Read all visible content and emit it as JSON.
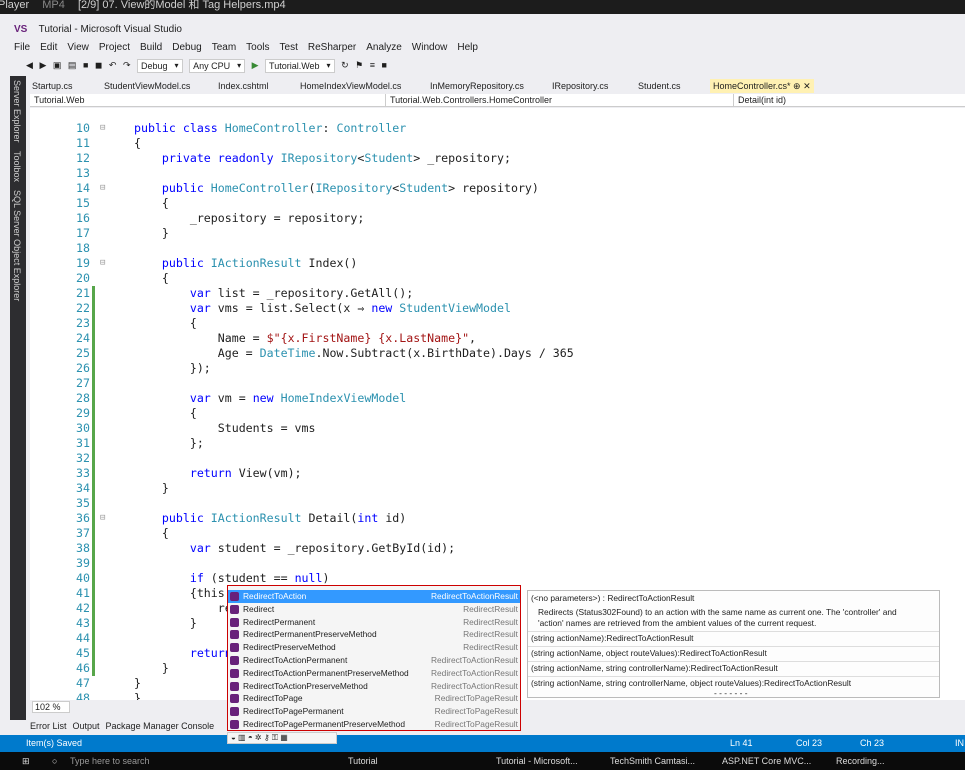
{
  "player": {
    "app": "Player",
    "format": "MP4",
    "title": "[2/9] 07. View的Model 和 Tag Helpers.mp4"
  },
  "window": {
    "title": "Tutorial - Microsoft Visual Studio",
    "logo": "VS"
  },
  "menu": [
    "File",
    "Edit",
    "View",
    "Project",
    "Build",
    "Debug",
    "Team",
    "Tools",
    "Test",
    "ReSharper",
    "Analyze",
    "Window",
    "Help"
  ],
  "toolbar": {
    "config": "Debug",
    "platform": "Any CPU",
    "run": "Tutorial.Web"
  },
  "side_panels": [
    "Server Explorer",
    "Toolbox",
    "SQL Server Object Explorer"
  ],
  "tabs": [
    "Startup.cs",
    "StudentViewModel.cs",
    "Index.cshtml",
    "HomeIndexViewModel.cs",
    "InMemoryRepository.cs",
    "IRepository.cs",
    "Student.cs",
    "HomeController.cs*"
  ],
  "nav": {
    "project": "Tutorial.Web",
    "class": "Tutorial.Web.Controllers.HomeController",
    "member": "Detail(int id)"
  },
  "code": [
    {
      "n": "10",
      "t": "public class HomeController: Controller"
    },
    {
      "n": "11",
      "t": "{"
    },
    {
      "n": "12",
      "t": "    private readonly IRepository<Student> _repository;"
    },
    {
      "n": "13",
      "t": ""
    },
    {
      "n": "14",
      "t": "    public HomeController(IRepository<Student> repository)"
    },
    {
      "n": "15",
      "t": "    {"
    },
    {
      "n": "16",
      "t": "        _repository = repository;"
    },
    {
      "n": "17",
      "t": "    }"
    },
    {
      "n": "18",
      "t": ""
    },
    {
      "n": "19",
      "t": "    public IActionResult Index()"
    },
    {
      "n": "20",
      "t": "    {"
    },
    {
      "n": "21",
      "t": "        var list = _repository.GetAll();"
    },
    {
      "n": "22",
      "t": "        var vms = list.Select(x ⇒ new StudentViewModel"
    },
    {
      "n": "23",
      "t": "        {"
    },
    {
      "n": "24",
      "t": "            Name = $\"{x.FirstName} {x.LastName}\","
    },
    {
      "n": "25",
      "t": "            Age = DateTime.Now.Subtract(x.BirthDate).Days / 365"
    },
    {
      "n": "26",
      "t": "        });"
    },
    {
      "n": "27",
      "t": ""
    },
    {
      "n": "28",
      "t": "        var vm = new HomeIndexViewModel"
    },
    {
      "n": "29",
      "t": "        {"
    },
    {
      "n": "30",
      "t": "            Students = vms"
    },
    {
      "n": "31",
      "t": "        };"
    },
    {
      "n": "32",
      "t": ""
    },
    {
      "n": "33",
      "t": "        return View(vm);"
    },
    {
      "n": "34",
      "t": "    }"
    },
    {
      "n": "35",
      "t": ""
    },
    {
      "n": "36",
      "t": "    public IActionResult Detail(int id)"
    },
    {
      "n": "37",
      "t": "    {"
    },
    {
      "n": "38",
      "t": "        var student = _repository.GetById(id);"
    },
    {
      "n": "39",
      "t": ""
    },
    {
      "n": "40",
      "t": "        if (student == null)"
    },
    {
      "n": "41",
      "t": "        {this.redi"
    },
    {
      "n": "42",
      "t": "            re"
    },
    {
      "n": "43",
      "t": "        }"
    },
    {
      "n": "44",
      "t": ""
    },
    {
      "n": "45",
      "t": "        return"
    },
    {
      "n": "46",
      "t": "    }"
    },
    {
      "n": "47",
      "t": "}"
    },
    {
      "n": "48",
      "t": "}"
    }
  ],
  "zoom": "102 %",
  "bottom_tabs": [
    "Error List",
    "Output",
    "Package Manager Console"
  ],
  "status": {
    "msg": "Item(s) Saved",
    "ln": "Ln 41",
    "col": "Col 23",
    "ch": "Ch 23",
    "mode": "IN"
  },
  "intellisense": [
    {
      "name": "RedirectToAction",
      "ret": "RedirectToActionResult"
    },
    {
      "name": "Redirect",
      "ret": "RedirectResult"
    },
    {
      "name": "RedirectPermanent",
      "ret": "RedirectResult"
    },
    {
      "name": "RedirectPermanentPreserveMethod",
      "ret": "RedirectResult"
    },
    {
      "name": "RedirectPreserveMethod",
      "ret": "RedirectResult"
    },
    {
      "name": "RedirectToActionPermanent",
      "ret": "RedirectToActionResult"
    },
    {
      "name": "RedirectToActionPermanentPreserveMethod",
      "ret": "RedirectToActionResult"
    },
    {
      "name": "RedirectToActionPreserveMethod",
      "ret": "RedirectToActionResult"
    },
    {
      "name": "RedirectToPage",
      "ret": "RedirectToPageResult"
    },
    {
      "name": "RedirectToPagePermanent",
      "ret": "RedirectToPageResult"
    },
    {
      "name": "RedirectToPagePermanentPreserveMethod",
      "ret": "RedirectToPageResult"
    }
  ],
  "tooltip": {
    "sig": "(<no parameters>) : RedirectToActionResult",
    "desc1": "Redirects (Status302Found) to an action with the same name as current one. The 'controller' and",
    "desc2": "'action' names are retrieved from the ambient values of the current request.",
    "overloads": [
      "(string actionName):RedirectToActionResult",
      "(string actionName, object routeValues):RedirectToActionResult",
      "(string actionName, string controllerName):RedirectToActionResult",
      "(string actionName, string controllerName, object routeValues):RedirectToActionResult"
    ],
    "more": "- - - - - - -"
  },
  "taskbar": {
    "search": "Type here to search",
    "items": [
      "Tutorial",
      "Tutorial - Microsoft...",
      "TechSmith Camtasi...",
      "ASP.NET Core MVC...",
      "Recording..."
    ]
  }
}
